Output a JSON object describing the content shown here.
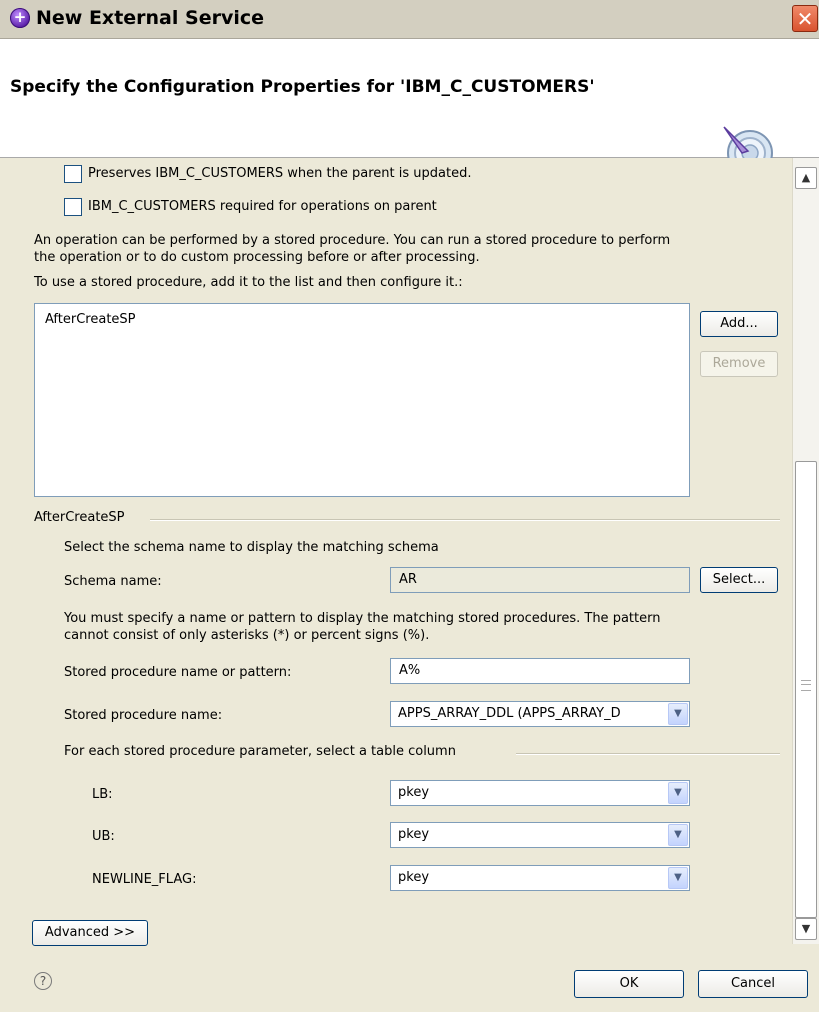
{
  "window": {
    "title": "New External Service",
    "close_glyph": "✕"
  },
  "banner": {
    "heading": "Specify the Configuration Properties for 'IBM_C_CUSTOMERS'"
  },
  "checkboxes": [
    {
      "label": "Preserves IBM_C_CUSTOMERS when the parent is updated.",
      "checked": false
    },
    {
      "label": "IBM_C_CUSTOMERS required for operations on parent",
      "checked": false
    }
  ],
  "stored_procedures": {
    "description_line1": "An operation can be performed by a stored procedure. You can run a stored procedure to perform",
    "description_line2": "the operation or to do custom processing before or after processing.",
    "list_label": "To use a stored procedure, add it to the list and then configure it.:",
    "items": [
      "AfterCreateSP"
    ],
    "add_label": "Add...",
    "remove_label": "Remove"
  },
  "group": {
    "title": "AfterCreateSP",
    "schema_hint": "Select the schema name to display the matching schema",
    "schema_label": "Schema name:",
    "schema_value": "AR",
    "select_label": "Select...",
    "pattern_hint_line1": "You must specify a name or pattern to display the matching stored procedures. The pattern",
    "pattern_hint_line2": "cannot consist of only asterisks (*) or percent signs (%).",
    "pattern_label": "Stored procedure name or pattern:",
    "pattern_value": "A%",
    "sp_name_label": "Stored procedure name:",
    "sp_name_value": "APPS_ARRAY_DDL (APPS_ARRAY_D",
    "param_title": "For each stored procedure parameter, select a table column",
    "params": [
      {
        "label": "LB:",
        "value": "pkey"
      },
      {
        "label": "UB:",
        "value": "pkey"
      },
      {
        "label": "NEWLINE_FLAG:",
        "value": "pkey"
      }
    ]
  },
  "advanced_label": "Advanced >>",
  "footer": {
    "help_glyph": "?",
    "ok_label": "OK",
    "cancel_label": "Cancel"
  },
  "scrollbar": {
    "up_glyph": "▲",
    "down_glyph": "▼",
    "drop_glyph": "▼"
  }
}
